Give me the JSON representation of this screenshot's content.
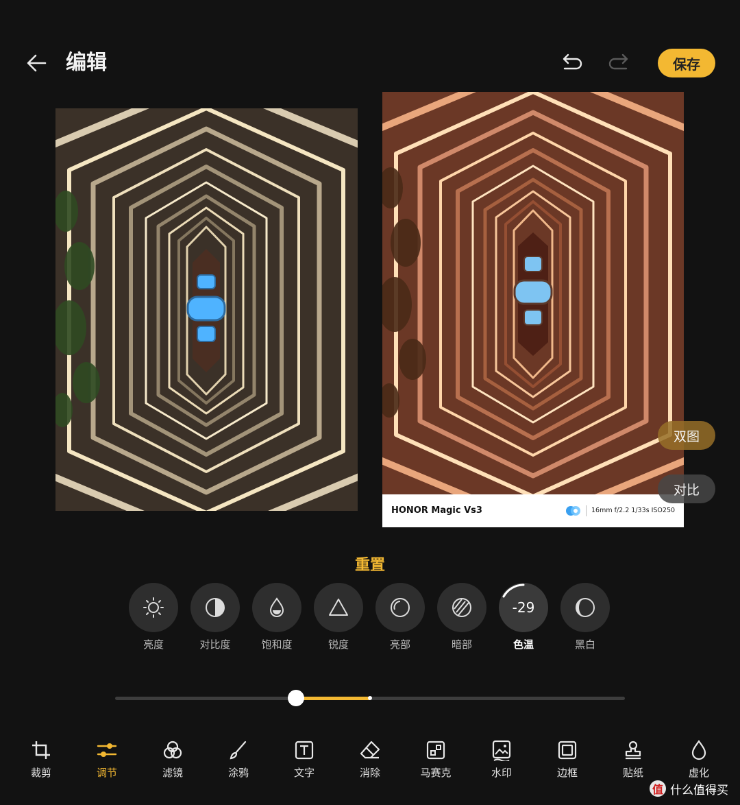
{
  "header": {
    "title": "编辑",
    "save_label": "保存"
  },
  "photos": {
    "watermark": {
      "model": "HONOR Magic Vs3",
      "params": "16mm  f/2.2  1/33s  ISO250"
    }
  },
  "side_buttons": {
    "dual_label": "双图",
    "compare_label": "对比"
  },
  "adjust": {
    "reset_label": "重置",
    "tools": [
      {
        "label": "亮度",
        "icon": "sun-icon"
      },
      {
        "label": "对比度",
        "icon": "contrast-icon"
      },
      {
        "label": "饱和度",
        "icon": "drop-icon"
      },
      {
        "label": "锐度",
        "icon": "triangle-icon"
      },
      {
        "label": "亮部",
        "icon": "highlights-icon"
      },
      {
        "label": "暗部",
        "icon": "shadows-icon"
      },
      {
        "label": "色温",
        "icon": "temperature-icon",
        "value": "-29",
        "active": true
      },
      {
        "label": "黑白",
        "icon": "bw-icon"
      }
    ],
    "slider": {
      "min": -100,
      "max": 100,
      "value": -29
    }
  },
  "bottom_nav": [
    {
      "label": "裁剪",
      "icon": "crop-icon"
    },
    {
      "label": "调节",
      "icon": "adjust-icon",
      "active": true
    },
    {
      "label": "滤镜",
      "icon": "filter-icon"
    },
    {
      "label": "涂鸦",
      "icon": "brush-icon"
    },
    {
      "label": "文字",
      "icon": "text-icon"
    },
    {
      "label": "消除",
      "icon": "eraser-icon"
    },
    {
      "label": "马赛克",
      "icon": "mosaic-icon"
    },
    {
      "label": "水印",
      "icon": "watermark-icon"
    },
    {
      "label": "边框",
      "icon": "frame-icon"
    },
    {
      "label": "贴纸",
      "icon": "sticker-icon"
    },
    {
      "label": "虚化",
      "icon": "blur-icon"
    }
  ],
  "brand": {
    "badge": "值",
    "text": "什么值得买"
  },
  "colors": {
    "accent": "#f3b832",
    "background": "#121212"
  }
}
